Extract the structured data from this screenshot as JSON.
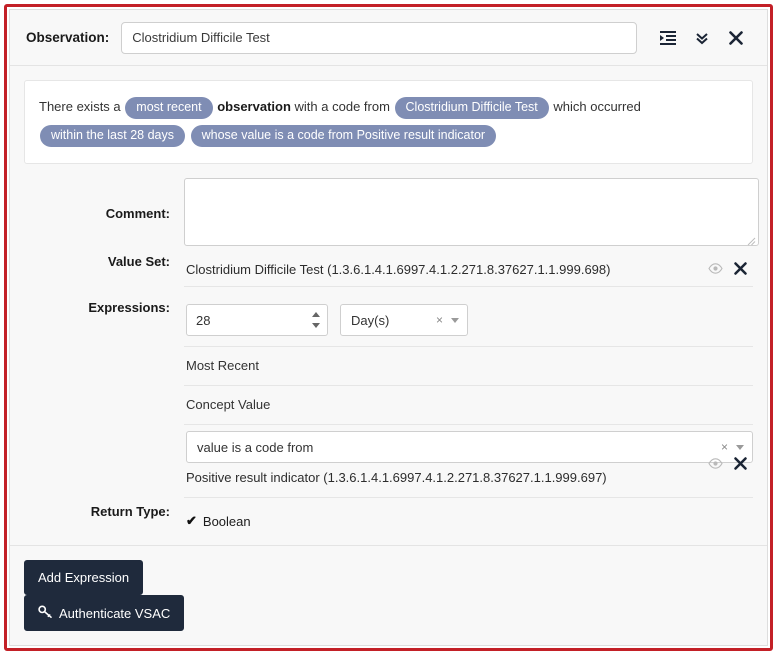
{
  "header": {
    "label": "Observation:",
    "input_value": "Clostridium Difficile Test",
    "input_placeholder": "",
    "icons": {
      "detail": "indent-list-icon",
      "collapse": "angle-double-down-icon",
      "close": "close-icon"
    }
  },
  "phrase": {
    "prefix": "There exists a",
    "pill_most_recent": "most recent",
    "bold_observation": "observation",
    "mid": "with a code from",
    "pill_valueset": "Clostridium Difficile Test",
    "suffix": "which occurred",
    "pill_timing": "within the last 28 days",
    "pill_value": "whose value is a code from Positive result indicator"
  },
  "form": {
    "comment": {
      "label": "Comment:",
      "value": "",
      "placeholder": ""
    },
    "value_set": {
      "label": "Value Set:",
      "text": "Clostridium Difficile Test (1.3.6.1.4.1.6997.4.1.2.271.8.37627.1.1.999.698)"
    },
    "expressions": {
      "label": "Expressions:",
      "quantity": "28",
      "unit": "Day(s)",
      "unit_clear": "×",
      "rows": [
        "Most Recent",
        "Concept Value"
      ],
      "value_operator": "value is a code from",
      "value_operator_clear": "×",
      "value_set_text": "Positive result indicator (1.3.6.1.4.1.6997.4.1.2.271.8.37627.1.1.999.697)"
    },
    "return_type": {
      "label": "Return Type:",
      "check": "✔",
      "value": "Boolean"
    }
  },
  "footer": {
    "add_expression": "Add Expression",
    "authenticate_vsac": "Authenticate VSAC"
  },
  "colors": {
    "error_border": "#c32027",
    "pill": "#7f8db4",
    "button_dark": "#1f2a3c",
    "panel_bg": "#f8f8f8"
  }
}
